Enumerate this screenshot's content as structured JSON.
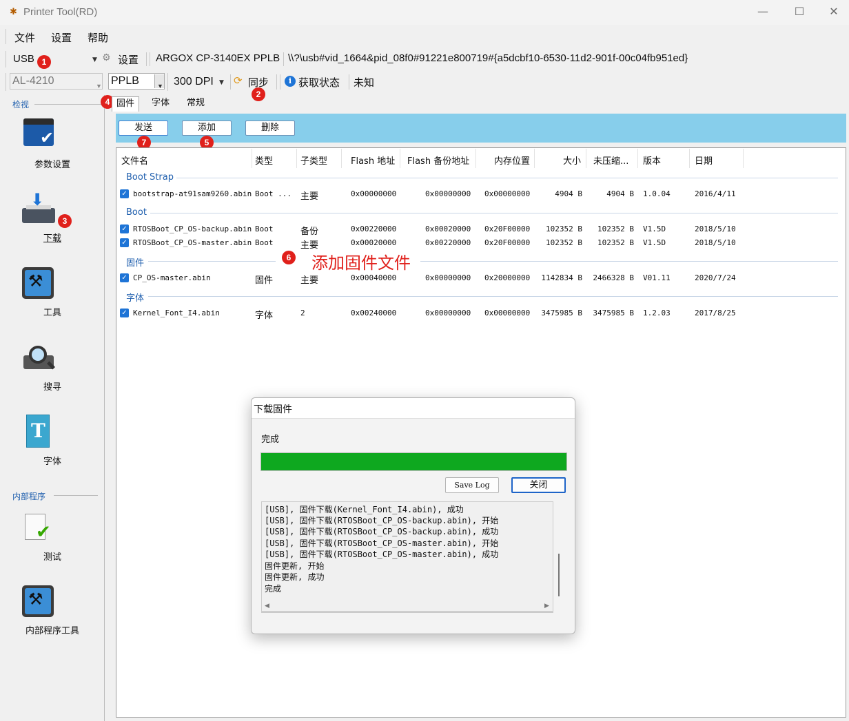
{
  "window": {
    "title": "Printer Tool(RD)",
    "min": "—",
    "max": "☐",
    "close": "✕"
  },
  "menu": [
    "文件",
    "设置",
    "帮助"
  ],
  "toolbar1": {
    "port": "USB",
    "settings_label": "设置",
    "printer_name": "ARGOX CP-3140EX PPLB",
    "device_path": "\\\\?\\usb#vid_1664&pid_08f0#91221e800719#{a5dcbf10-6530-11d2-901f-00c04fb951ed}"
  },
  "toolbar2": {
    "model": "AL-4210",
    "language": "PPLB",
    "dpi": "300 DPI",
    "sync_label": "同步",
    "status_label": "获取状态",
    "status_value": "未知"
  },
  "badges": [
    "1",
    "2",
    "3",
    "4",
    "5",
    "6",
    "7"
  ],
  "sidebar": {
    "view_group": "检视",
    "items": [
      "参数设置",
      "下载",
      "工具",
      "搜寻",
      "字体"
    ],
    "internal_group": "内部程序",
    "internal_items": [
      "测试",
      "内部程序工具"
    ]
  },
  "tabs": [
    "固件",
    "字体",
    "常规"
  ],
  "actions": {
    "send": "发送",
    "add": "添加",
    "delete": "删除"
  },
  "columns": [
    "文件名",
    "类型",
    "子类型",
    "Flash 地址",
    "Flash 备份地址",
    "内存位置",
    "大小",
    "未压缩...",
    "版本",
    "日期"
  ],
  "groups": [
    {
      "name": "Boot Strap",
      "rows": [
        {
          "file": "bootstrap-at91sam9260.abin",
          "type": "Boot ...",
          "subtype": "主要",
          "flash": "0x00000000",
          "backup": "0x00000000",
          "mem": "0x00000000",
          "size": "4904 B",
          "uncomp": "4904 B",
          "version": "1.0.04",
          "date": "2016/4/11"
        }
      ]
    },
    {
      "name": "Boot",
      "rows": [
        {
          "file": "RTOSBoot_CP_OS-backup.abin",
          "type": "Boot",
          "subtype": "备份",
          "flash": "0x00220000",
          "backup": "0x00020000",
          "mem": "0x20F00000",
          "size": "102352 B",
          "uncomp": "102352 B",
          "version": "V1.5D",
          "date": "2018/5/10"
        },
        {
          "file": "RTOSBoot_CP_OS-master.abin",
          "type": "Boot",
          "subtype": "主要",
          "flash": "0x00020000",
          "backup": "0x00220000",
          "mem": "0x20F00000",
          "size": "102352 B",
          "uncomp": "102352 B",
          "version": "V1.5D",
          "date": "2018/5/10"
        }
      ]
    },
    {
      "name": "固件",
      "rows": [
        {
          "file": "CP_OS-master.abin",
          "type": "固件",
          "subtype": "主要",
          "flash": "0x00040000",
          "backup": "0x00000000",
          "mem": "0x20000000",
          "size": "1142834 B",
          "uncomp": "2466328 B",
          "version": "V01.11",
          "date": "2020/7/24"
        }
      ]
    },
    {
      "name": "字体",
      "rows": [
        {
          "file": "Kernel_Font_I4.abin",
          "type": "字体",
          "subtype": "2",
          "flash": "0x00240000",
          "backup": "0x00000000",
          "mem": "0x00000000",
          "size": "3475985 B",
          "uncomp": "3475985 B",
          "version": "1.2.03",
          "date": "2017/8/25"
        }
      ]
    }
  ],
  "annotation6": "添加固件文件",
  "dialog": {
    "title": "下载固件",
    "status": "完成",
    "progress": 1.0,
    "progress_color": "#0ea81f",
    "save_log": "Save Log",
    "close": "关闭",
    "log": [
      "[USB], 固件下载(Kernel_Font_I4.abin), 成功",
      "[USB], 固件下载(RTOSBoot_CP_OS-backup.abin), 开始",
      "[USB], 固件下载(RTOSBoot_CP_OS-backup.abin), 成功",
      "[USB], 固件下载(RTOSBoot_CP_OS-master.abin), 开始",
      "[USB], 固件下载(RTOSBoot_CP_OS-master.abin), 成功",
      "固件更新, 开始",
      "固件更新, 成功",
      "完成"
    ]
  },
  "colors": {
    "accent_blue_bar": "#87ceeb",
    "badge_red": "#e0201b",
    "check_blue": "#1e74d6"
  }
}
